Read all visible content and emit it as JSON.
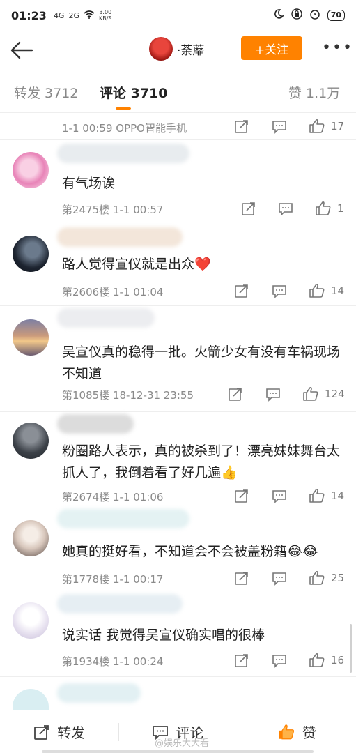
{
  "status": {
    "time": "01:23",
    "net1": "4G",
    "net2": "2G",
    "speed_value": "3.00",
    "speed_unit": "KB/S",
    "battery": "70"
  },
  "header": {
    "username": "·荼蘼",
    "follow_label": "+关注",
    "more": "•••"
  },
  "tabs": {
    "repost": "转发 3712",
    "comment": "评论 3710",
    "like": "赞 1.1万"
  },
  "top_meta": {
    "meta": "1-1 00:59  OPPO智能手机",
    "likes": "17"
  },
  "comments": [
    {
      "text": "有气场诶",
      "meta": "第2475楼  1-1 00:57",
      "likes": "1"
    },
    {
      "text": "路人觉得宣仪就是出众❤️",
      "meta": "第2606楼  1-1 01:04",
      "likes": "14"
    },
    {
      "text": "吴宣仪真的稳得一批。火箭少女有没有车祸现场不知道",
      "meta": "第1085楼  18-12-31 23:55",
      "likes": "124"
    },
    {
      "text": "粉圈路人表示，真的被杀到了！漂亮妹妹舞台太抓人了，我倒着看了好几遍👍",
      "meta": "第2674楼  1-1 01:06",
      "likes": "14"
    },
    {
      "text": "她真的挺好看，不知道会不会被盖粉籍😂😂",
      "meta": "第1778楼  1-1 00:17",
      "likes": "25"
    },
    {
      "text": "说实话 我觉得吴宣仪确实唱的很棒",
      "meta": "第1934楼  1-1 00:24",
      "likes": "16"
    }
  ],
  "bottom": {
    "repost": "转发",
    "comment": "评论",
    "like": "赞"
  },
  "watermark": "@娱乐大大看",
  "colors": {
    "accent": "#ff8200",
    "meta": "#8a8a8a"
  }
}
